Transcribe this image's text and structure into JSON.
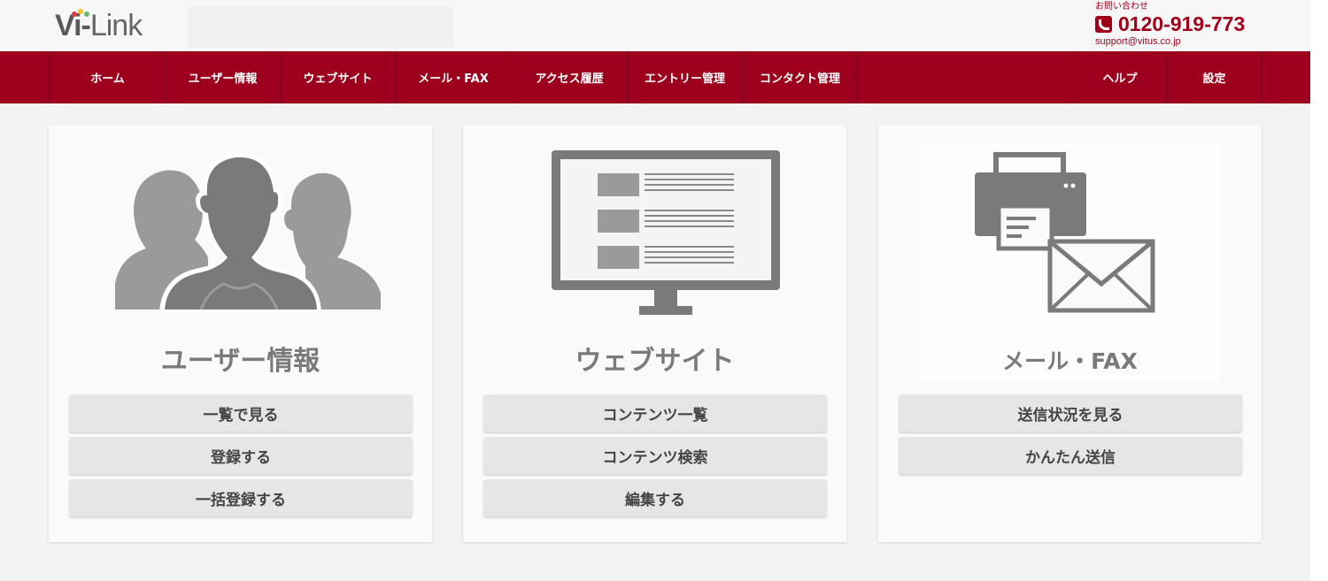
{
  "header": {
    "logo": {
      "vi": "Vi",
      "dash": "-",
      "link": "Link"
    },
    "contact": {
      "label": "お問い合わせ",
      "phone": "0120-919-773",
      "email": "support@vitus.co.jp"
    }
  },
  "nav": {
    "left": [
      "ホーム",
      "ユーザー情報",
      "ウェブサイト",
      "メール・FAX",
      "アクセス履歴",
      "エントリー管理",
      "コンタクト管理"
    ],
    "right": [
      "ヘルプ",
      "設定"
    ]
  },
  "cards": [
    {
      "title": "ユーザー情報",
      "icon": "users-icon",
      "buttons": [
        "一覧で見る",
        "登録する",
        "一括登録する"
      ]
    },
    {
      "title": "ウェブサイト",
      "icon": "monitor-icon",
      "buttons": [
        "コンテンツ一覧",
        "コンテンツ検索",
        "編集する"
      ]
    },
    {
      "title": "メール・FAX",
      "icon": "fax-mail-icon",
      "buttons": [
        "送信状況を見る",
        "かんたん送信"
      ]
    }
  ],
  "colors": {
    "brand": "#9c001c",
    "icon_gray": "#7a7a7a",
    "button_bg": "#e6e6e6"
  }
}
